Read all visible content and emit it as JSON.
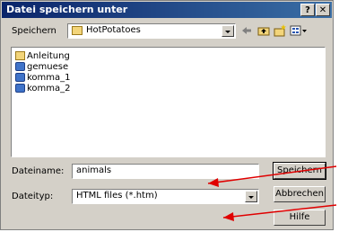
{
  "window": {
    "title": "Datei speichern unter",
    "help_btn": "?",
    "close_btn": "✕"
  },
  "location": {
    "label": "Speichern",
    "current": "HotPotatoes"
  },
  "toolbar": {
    "icons": [
      "back-arrow-icon",
      "up-folder-icon",
      "new-folder-icon",
      "view-menu-icon"
    ]
  },
  "files": [
    {
      "name": "Anleitung",
      "type": "folder"
    },
    {
      "name": "gemuese",
      "type": "htm"
    },
    {
      "name": "komma_1",
      "type": "htm"
    },
    {
      "name": "komma_2",
      "type": "htm"
    }
  ],
  "filename": {
    "label": "Dateiname:",
    "value": "animals"
  },
  "filetype": {
    "label": "Dateityp:",
    "value": "HTML files (*.htm)"
  },
  "buttons": {
    "save": "Speichern",
    "cancel": "Abbrechen",
    "help": "Hilfe"
  },
  "colors": {
    "annotation_arrow": "#e00000",
    "titlebar": "#0a246a"
  }
}
